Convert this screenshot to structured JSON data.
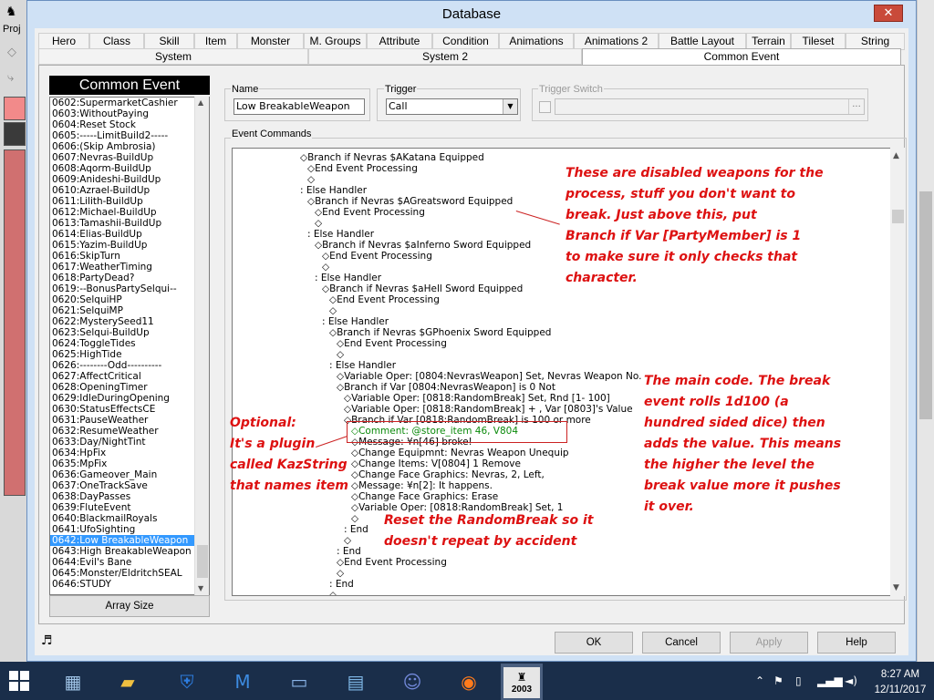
{
  "window": {
    "title": "Database",
    "close_label": "✕"
  },
  "bg": {
    "left_labels": [
      "Proj"
    ]
  },
  "tabs_row1": [
    "Hero",
    "Class",
    "Skill",
    "Item",
    "Monster",
    "M. Groups",
    "Attribute",
    "Condition",
    "Animations",
    "Animations 2",
    "Battle Layout",
    "Terrain",
    "Tileset",
    "String"
  ],
  "tabs_row2": [
    "System",
    "System 2",
    "Common Event"
  ],
  "common_event": {
    "header": "Common Event",
    "items": [
      "0602:SupermarketCashier",
      "0603:WithoutPaying",
      "0604:Reset Stock",
      "0605:-----LimitBuild2-----",
      "0606:(Skip Ambrosia)",
      "0607:Nevras-BuildUp",
      "0608:Aqorm-BuildUp",
      "0609:Anideshi-BuildUp",
      "0610:Azrael-BuildUp",
      "0611:Lilith-BuildUp",
      "0612:Michael-BuildUp",
      "0613:Tamashii-BuildUp",
      "0614:Elias-BuildUp",
      "0615:Yazim-BuildUp",
      "0616:SkipTurn",
      "0617:WeatherTiming",
      "0618:PartyDead?",
      "0619:--BonusPartySelqui--",
      "0620:SelquiHP",
      "0621:SelquiMP",
      "0622:MysterySeed11",
      "0623:Selqui-BuildUp",
      "0624:ToggleTides",
      "0625:HighTide",
      "0626:--------Odd----------",
      "0627:AffectCritical",
      "0628:OpeningTimer",
      "0629:IdleDuringOpening",
      "0630:StatusEffectsCE",
      "0631:PauseWeather",
      "0632:ResumeWeather",
      "0633:Day/NightTint",
      "0634:HpFix",
      "0635:MpFix",
      "0636:Gameover_Main",
      "0637:OneTrackSave",
      "0638:DayPasses",
      "0639:FluteEvent",
      "0640:BlackmailRoyals",
      "0641:UfoSighting",
      "0642:Low BreakableWeapon",
      "0643:High BreakableWeapon",
      "0644:Evil's Bane",
      "0645:Monster/EldritchSEAL",
      "0646:STUDY"
    ],
    "selected_index": 40,
    "array_size_label": "Array Size"
  },
  "fields": {
    "name_label": "Name",
    "name_value": "Low BreakableWeapon",
    "trigger_label": "Trigger",
    "trigger_value": "Call",
    "trigger_switch_label": "Trigger Switch",
    "trigger_switch_value": "",
    "switch_more": "...",
    "event_commands_label": "Event Commands"
  },
  "commands": [
    {
      "indent": 0,
      "text": "◇Branch if Nevras $AKatana Equipped"
    },
    {
      "indent": 1,
      "text": "◇End Event Processing"
    },
    {
      "indent": 1,
      "text": "◇"
    },
    {
      "indent": 0,
      "text": ": Else Handler"
    },
    {
      "indent": 1,
      "text": "◇Branch if Nevras $AGreatsword Equipped"
    },
    {
      "indent": 2,
      "text": "◇End Event Processing"
    },
    {
      "indent": 2,
      "text": "◇"
    },
    {
      "indent": 1,
      "text": ": Else Handler"
    },
    {
      "indent": 2,
      "text": "◇Branch if Nevras $aInferno Sword Equipped"
    },
    {
      "indent": 3,
      "text": "◇End Event Processing"
    },
    {
      "indent": 3,
      "text": "◇"
    },
    {
      "indent": 2,
      "text": ": Else Handler"
    },
    {
      "indent": 3,
      "text": "◇Branch if Nevras $aHell Sword Equipped"
    },
    {
      "indent": 4,
      "text": "◇End Event Processing"
    },
    {
      "indent": 4,
      "text": "◇"
    },
    {
      "indent": 3,
      "text": ": Else Handler"
    },
    {
      "indent": 4,
      "text": "◇Branch if Nevras $GPhoenix Sword Equipped"
    },
    {
      "indent": 5,
      "text": "◇End Event Processing"
    },
    {
      "indent": 5,
      "text": "◇"
    },
    {
      "indent": 4,
      "text": ": Else Handler"
    },
    {
      "indent": 5,
      "text": "◇Variable Oper: [0804:NevrasWeapon] Set, Nevras Weapon No."
    },
    {
      "indent": 5,
      "text": "◇Branch if Var [0804:NevrasWeapon] is 0 Not"
    },
    {
      "indent": 6,
      "text": "◇Variable Oper: [0818:RandomBreak] Set, Rnd [1- 100]"
    },
    {
      "indent": 6,
      "text": "◇Variable Oper: [0818:RandomBreak] + , Var [0803]'s Value"
    },
    {
      "indent": 6,
      "text": "◇Branch if Var [0818:RandomBreak] is 100 or more"
    },
    {
      "indent": 7,
      "text": "◇Comment: @store_item 46, V804",
      "comment": true
    },
    {
      "indent": 7,
      "text": "◇Message: ¥n[46] broke!"
    },
    {
      "indent": 7,
      "text": "◇Change Equipmnt: Nevras Weapon Unequip"
    },
    {
      "indent": 7,
      "text": "◇Change Items: V[0804] 1 Remove"
    },
    {
      "indent": 7,
      "text": "◇Change Face Graphics: Nevras, 2, Left,"
    },
    {
      "indent": 7,
      "text": "◇Message: ¥n[2]: It happens."
    },
    {
      "indent": 7,
      "text": "◇Change Face Graphics: Erase"
    },
    {
      "indent": 7,
      "text": "◇Variable Oper: [0818:RandomBreak] Set, 1"
    },
    {
      "indent": 7,
      "text": "◇"
    },
    {
      "indent": 6,
      "text": ": End"
    },
    {
      "indent": 6,
      "text": "◇"
    },
    {
      "indent": 5,
      "text": ": End"
    },
    {
      "indent": 5,
      "text": "◇End Event Processing"
    },
    {
      "indent": 5,
      "text": "◇"
    },
    {
      "indent": 4,
      "text": ": End"
    },
    {
      "indent": 4,
      "text": "◇"
    }
  ],
  "annotations": {
    "disabled": [
      "These are disabled weapons for the",
      "process, stuff you don't want to",
      "break. Just above this, put",
      "Branch if Var [PartyMember] is 1",
      "to make sure it only checks that",
      "character."
    ],
    "main_code": [
      "The main code. The break",
      "event rolls 1d100 (a",
      "hundred sided dice) then",
      "adds the value. This means",
      "the higher the level the",
      "break value more it pushes",
      "it over."
    ],
    "optional": [
      "Optional:",
      "It's a plugin",
      "called KazString",
      "that names item"
    ],
    "reset": [
      "Reset the RandomBreak so it",
      "doesn't repeat by accident"
    ]
  },
  "buttons": {
    "ok": "OK",
    "cancel": "Cancel",
    "apply": "Apply",
    "help": "Help"
  },
  "taskbar": {
    "time": "8:27 AM",
    "date": "12/11/2017",
    "app_label": "2003",
    "icons": [
      "windows-start-icon",
      "calculator-icon",
      "file-explorer-icon",
      "security-shield-icon",
      "malwarebytes-icon",
      "powershell-icon",
      "control-panel-icon",
      "discord-icon",
      "firefox-icon",
      "rpgmaker-2003-icon"
    ]
  },
  "colors": {
    "annotation": "#dd1111",
    "selection": "#3399ff",
    "comment": "#0a8a0a",
    "taskbar": "#1a2e4a"
  }
}
